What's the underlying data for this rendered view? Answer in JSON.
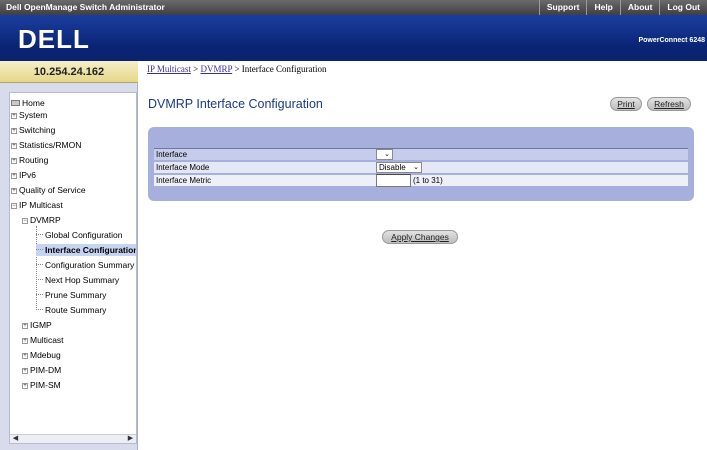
{
  "topbar": {
    "title": "Dell OpenManage Switch Administrator",
    "links": [
      "Support",
      "Help",
      "About",
      "Log Out"
    ]
  },
  "banner": {
    "logo_text": "DELL",
    "model": "PowerConnect 6248"
  },
  "sidebar": {
    "ip": "10.254.24.162",
    "tree": {
      "home": "Home",
      "system": "System",
      "switching": "Switching",
      "statistics": "Statistics/RMON",
      "routing": "Routing",
      "ipv6": "IPv6",
      "qos": "Quality of Service",
      "ip_multicast": "IP Multicast",
      "dvmrp": "DVMRP",
      "global_config": "Global Configuration",
      "interface_config": "Interface Configuration",
      "config_summary": "Configuration Summary",
      "next_hop": "Next Hop Summary",
      "prune": "Prune Summary",
      "route": "Route Summary",
      "igmp": "IGMP",
      "multicast": "Multicast",
      "mdebug": "Mdebug",
      "pimdm": "PIM-DM",
      "pimsm": "PIM-SM"
    }
  },
  "breadcrumb": {
    "part1": "IP Multicast",
    "sep": " > ",
    "part2": "DVMRP",
    "part3": "Interface Configuration"
  },
  "main": {
    "title": "DVMRP Interface Configuration",
    "print_label": "Print",
    "refresh_label": "Refresh",
    "form": {
      "interface_label": "Interface",
      "interface_value": "",
      "mode_label": "Interface Mode",
      "mode_value": "Disable",
      "metric_label": "Interface Metric",
      "metric_value": "",
      "metric_hint": "(1 to 31)"
    },
    "apply_label": "Apply Changes"
  },
  "colors": {
    "banner": "#0a2474",
    "sidebar": "#d7dbeb",
    "panel": "#a7b0dd",
    "title": "#1a3a8a",
    "selected_item": "#c6d3f2"
  }
}
